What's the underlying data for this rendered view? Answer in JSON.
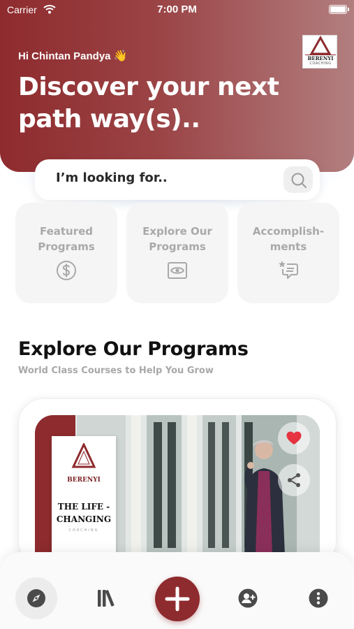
{
  "status_bar": {
    "carrier": "Carrier",
    "time": "7:00 PM"
  },
  "header": {
    "greeting": "Hi Chintan Pandya",
    "greeting_emoji": "👋",
    "headline": "Discover your next path way(s)..",
    "logo_text_top": "BERENYI",
    "logo_text_bottom": "COACHING"
  },
  "search": {
    "placeholder": "I’m looking for..",
    "icon": "search-icon"
  },
  "categories": [
    {
      "label": "Featured\nPrograms",
      "icon": "dollar-icon"
    },
    {
      "label": "Explore Our\nPrograms",
      "icon": "eye-icon"
    },
    {
      "label": "Accomplish-\nments",
      "icon": "star-chat-icon"
    }
  ],
  "section": {
    "title": "Explore Our Programs",
    "subtitle": "World Class Courses to Help You Grow"
  },
  "program_card": {
    "book_brand": "BERENYI",
    "book_title": "THE LIFE -\nCHANGING",
    "book_subtitle": "COACHING",
    "favorite_icon": "heart-icon",
    "share_icon": "share-icon"
  },
  "tab_bar": {
    "items": [
      "compass-icon",
      "library-icon",
      "add-icon",
      "add-user-icon",
      "more-icon"
    ],
    "accent_color": "#8e2b2e"
  },
  "colors": {
    "brand": "#8e2b2e",
    "muted_text": "#a9a9a9"
  }
}
